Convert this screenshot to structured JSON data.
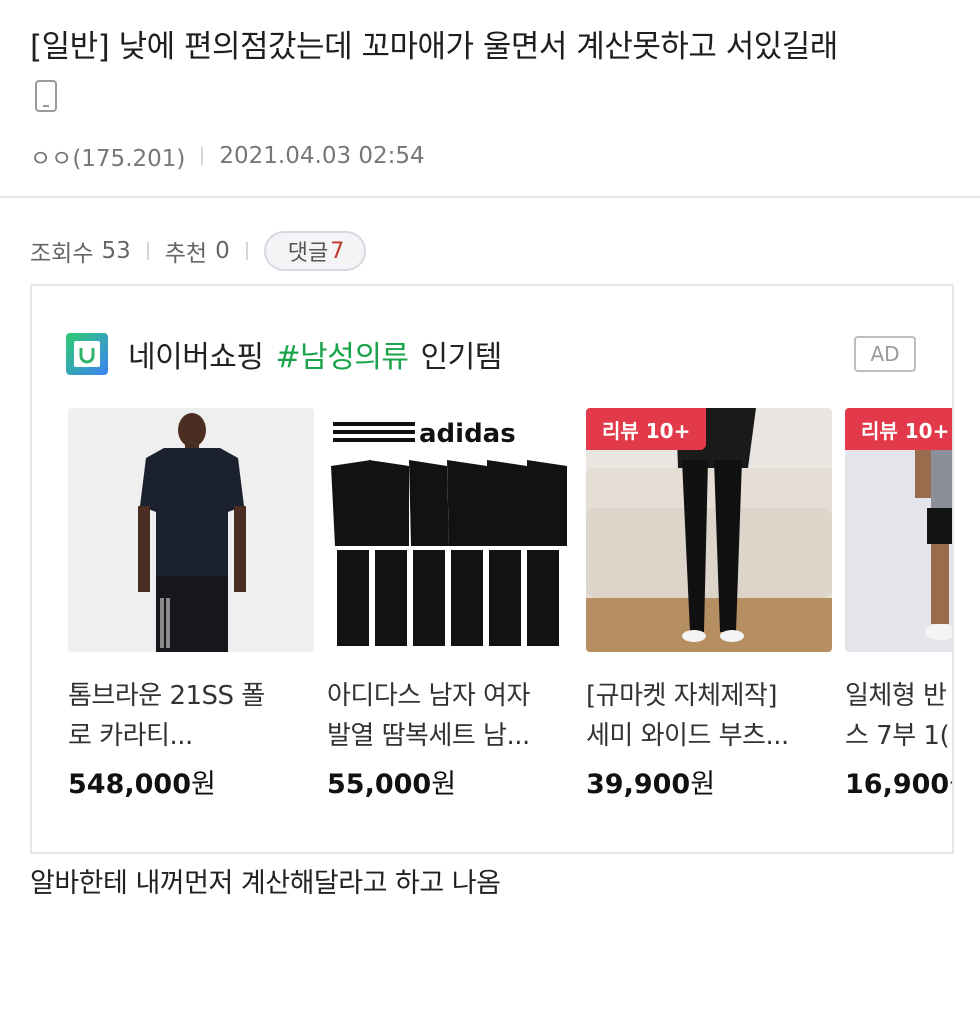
{
  "post": {
    "title": "[일반] 낮에 편의점갔는데 꼬마애가 울면서 계산못하고 서있길래",
    "device_icon": "mobile-phone-icon",
    "author": "ㅇㅇ(175.201)",
    "datetime": "2021.04.03 02:54",
    "views_label": "조회수",
    "views": "53",
    "recommend_label": "추천",
    "recommend": "0",
    "comments_label": "댓글",
    "comments": "7",
    "body": "알바한테 내꺼먼저 계산해달라고 하고 나옴"
  },
  "ad": {
    "brand": "네이버쇼핑",
    "hashtag": "#남성의류",
    "suffix": "인기템",
    "badge": "AD",
    "logo_icon": "naver-shopping-logo-icon",
    "products": [
      {
        "name": "톰브라운 21SS 폴\n로 카라티...",
        "price": "548,000",
        "unit": "원",
        "review_badge": "",
        "image": "black-polo-shirt-model-image"
      },
      {
        "name": "아디다스 남자 여자\n발열 땀복세트 남...",
        "price": "55,000",
        "unit": "원",
        "review_badge": "",
        "brand_text": "adidas",
        "image": "adidas-tracksuit-set-image"
      },
      {
        "name": "[규마켓 자체제작]\n세미 와이드 부츠...",
        "price": "39,900",
        "unit": "원",
        "review_badge": "리뷰 10+",
        "image": "wide-pants-sofa-image"
      },
      {
        "name": "일체형 반\n스 7부 1(",
        "price": "16,900",
        "unit": "원",
        "review_badge": "리뷰 10+",
        "image": "compression-shorts-image"
      }
    ]
  }
}
